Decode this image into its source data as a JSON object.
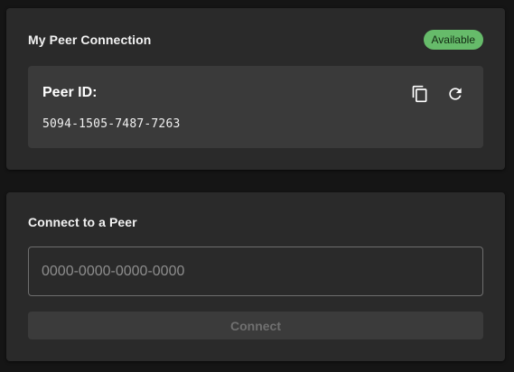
{
  "my_connection": {
    "title": "My Peer Connection",
    "status": "Available",
    "peer_id_label": "Peer ID:",
    "peer_id": "5094-1505-7487-7263",
    "copy_icon": "copy-icon",
    "refresh_icon": "refresh-icon"
  },
  "connect": {
    "title": "Connect to a Peer",
    "input_value": "",
    "input_placeholder": "0000-0000-0000-0000",
    "button_label": "Connect",
    "button_disabled": true
  },
  "colors": {
    "background": "#151515",
    "card": "#2a2a2a",
    "status_green": "#66bb6a",
    "disabled_button": "#3b3b3b"
  }
}
